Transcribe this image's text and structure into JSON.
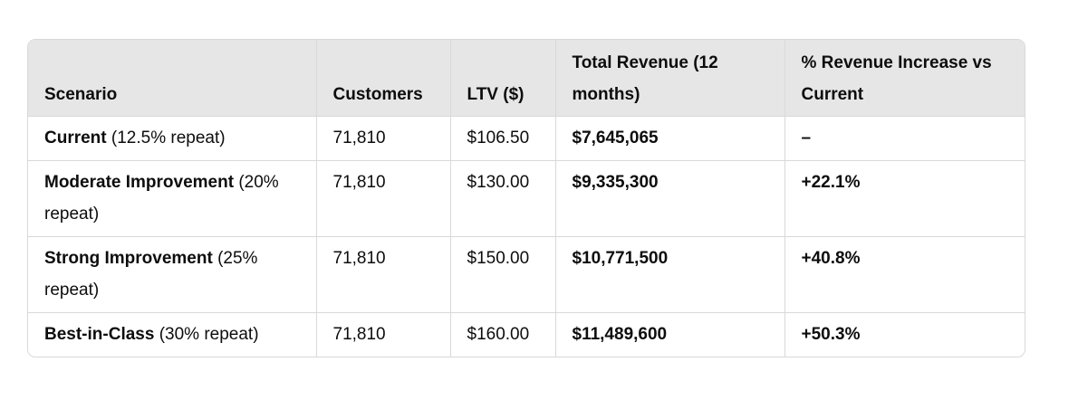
{
  "table": {
    "headers": {
      "scenario": "Scenario",
      "customers": "Customers",
      "ltv": "LTV ($)",
      "total_revenue": "Total Revenue (12 months)",
      "pct_increase": "% Revenue Increase vs Current"
    },
    "rows": [
      {
        "scenario_name": "Current",
        "scenario_detail": " (12.5% repeat)",
        "customers": "71,810",
        "ltv": "$106.50",
        "total_revenue": "$7,645,065",
        "pct_increase": "–"
      },
      {
        "scenario_name": "Moderate Improvement",
        "scenario_detail": " (20% repeat)",
        "customers": "71,810",
        "ltv": "$130.00",
        "total_revenue": "$9,335,300",
        "pct_increase": "+22.1%"
      },
      {
        "scenario_name": "Strong Improvement",
        "scenario_detail": " (25% repeat)",
        "customers": "71,810",
        "ltv": "$150.00",
        "total_revenue": "$10,771,500",
        "pct_increase": "+40.8%"
      },
      {
        "scenario_name": "Best-in-Class",
        "scenario_detail": " (30% repeat)",
        "customers": "71,810",
        "ltv": "$160.00",
        "total_revenue": "$11,489,600",
        "pct_increase": "+50.3%"
      }
    ]
  }
}
